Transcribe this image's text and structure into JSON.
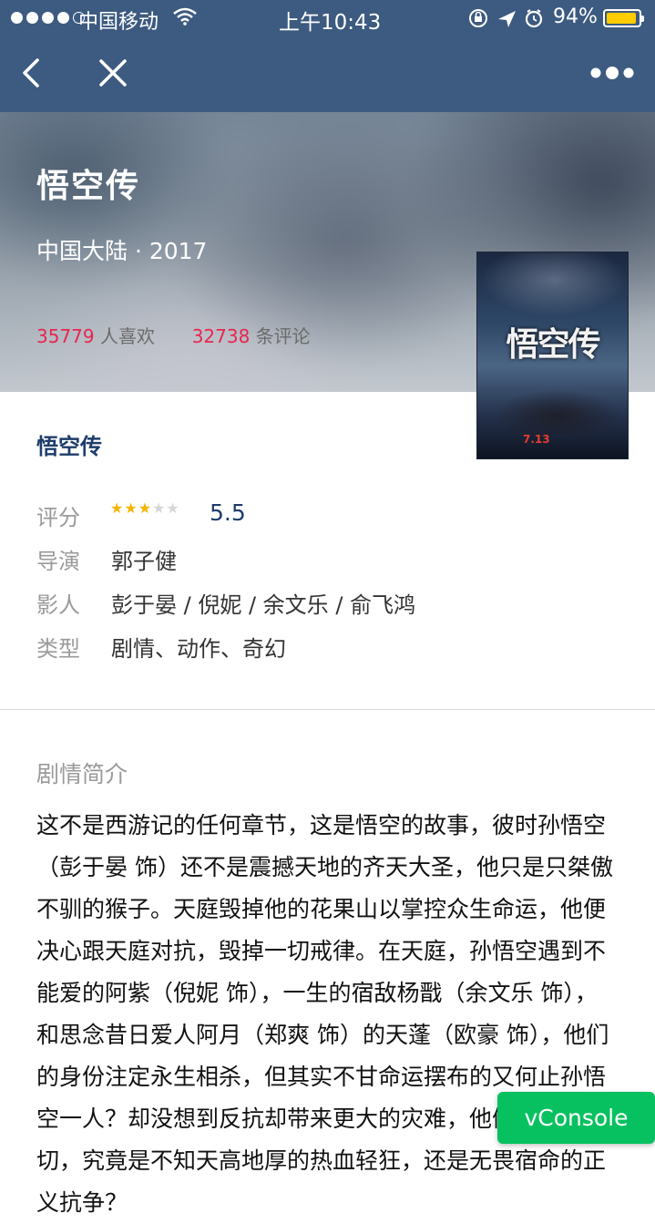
{
  "status_bar": {
    "carrier": "中国移动",
    "time": "上午10:43",
    "battery": "94%"
  },
  "hero": {
    "title": "悟空传",
    "meta": "中国大陆 · 2017",
    "likes_count": "35779",
    "likes_label": "人喜欢",
    "comments_count": "32738",
    "comments_label": "条评论"
  },
  "poster": {
    "title": "悟空传",
    "date": "7.13"
  },
  "info": {
    "title": "悟空传",
    "rating_label": "评分",
    "rating_stars": 3,
    "rating_max": 5,
    "rating_value": "5.5",
    "director_label": "导演",
    "director": "郭子健",
    "cast_label": "影人",
    "cast": "彭于晏 / 倪妮 / 余文乐 / 俞飞鸿",
    "genre_label": "类型",
    "genre": "剧情、动作、奇幻"
  },
  "synopsis": {
    "heading": "剧情简介",
    "text": "这不是西游记的任何章节，这是悟空的故事，彼时孙悟空（彭于晏 饰）还不是震撼天地的齐天大圣，他只是只桀傲不驯的猴子。天庭毁掉他的花果山以掌控众生命运，他便决心跟天庭对抗，毁掉一切戒律。在天庭，孙悟空遇到不能爱的阿紫（倪妮 饰），一生的宿敌杨戬（余文乐 饰），和思念昔日爱人阿月（郑爽 饰）的天蓬（欧豪 饰），他们的身份注定永生相杀，但其实不甘命运摆布的又何止孙悟空一人？却没想到反抗却带来更大的灾难，他们所做的一切，究竟是不知天高地厚的热血轻狂，还是无畏宿命的正义抗争？"
  },
  "vconsole": {
    "label": "vConsole"
  },
  "colors": {
    "nav_bg": "#3d5a80",
    "accent_red": "#e8264f",
    "title_blue": "#1e3d6b",
    "star_on": "#f5b400",
    "vconsole_green": "#07c160"
  }
}
